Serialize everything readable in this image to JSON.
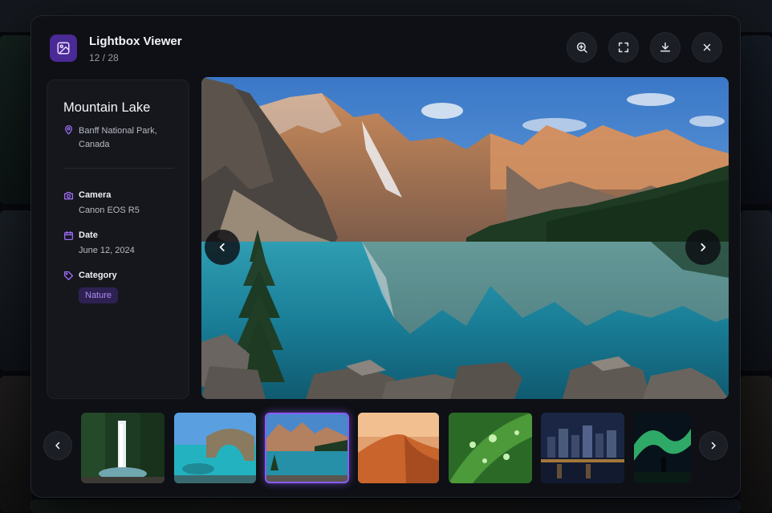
{
  "app": {
    "title": "Lightbox Viewer",
    "counter": "12 / 28",
    "icon": "image-icon"
  },
  "header_actions": [
    {
      "name": "zoom-in-button",
      "icon": "zoom-in-icon"
    },
    {
      "name": "fullscreen-button",
      "icon": "fullscreen-icon"
    },
    {
      "name": "download-button",
      "icon": "download-icon"
    },
    {
      "name": "close-button",
      "icon": "close-icon"
    }
  ],
  "photo": {
    "title": "Mountain Lake",
    "location": "Banff National Park, Canada",
    "camera_label": "Camera",
    "camera_value": "Canon EOS R5",
    "date_label": "Date",
    "date_value": "June 12, 2024",
    "category_label": "Category",
    "category_value": "Nature"
  },
  "thumbnails": [
    {
      "name": "thumb-waterfall",
      "subject": "waterfall",
      "active": false
    },
    {
      "name": "thumb-sea-arch",
      "subject": "sea arch",
      "active": false
    },
    {
      "name": "thumb-mountain-lake",
      "subject": "mountain lake",
      "active": true
    },
    {
      "name": "thumb-desert-dunes",
      "subject": "desert dunes",
      "active": false
    },
    {
      "name": "thumb-leaf-droplets",
      "subject": "leaf droplets",
      "active": false
    },
    {
      "name": "thumb-city-night",
      "subject": "city at night",
      "active": false
    },
    {
      "name": "thumb-aurora",
      "subject": "aurora",
      "active": false
    }
  ],
  "colors": {
    "accent": "#8b5cf6",
    "chip_bg": "#2e2152",
    "chip_text": "#a98cf2",
    "panel_bg": "#15171d",
    "modal_bg": "#0e1015"
  }
}
